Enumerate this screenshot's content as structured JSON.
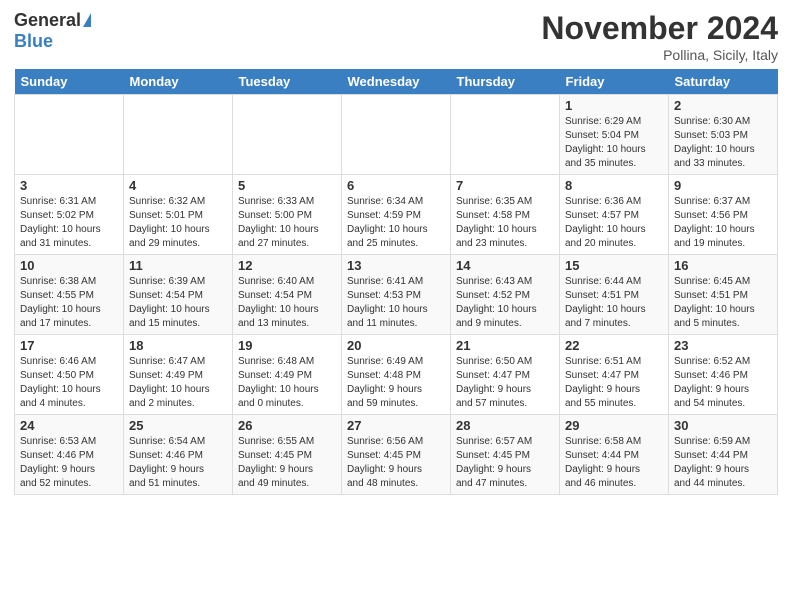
{
  "header": {
    "logo_general": "General",
    "logo_blue": "Blue",
    "month_title": "November 2024",
    "subtitle": "Pollina, Sicily, Italy"
  },
  "days_of_week": [
    "Sunday",
    "Monday",
    "Tuesday",
    "Wednesday",
    "Thursday",
    "Friday",
    "Saturday"
  ],
  "weeks": [
    [
      {
        "day": "",
        "info": ""
      },
      {
        "day": "",
        "info": ""
      },
      {
        "day": "",
        "info": ""
      },
      {
        "day": "",
        "info": ""
      },
      {
        "day": "",
        "info": ""
      },
      {
        "day": "1",
        "info": "Sunrise: 6:29 AM\nSunset: 5:04 PM\nDaylight: 10 hours\nand 35 minutes."
      },
      {
        "day": "2",
        "info": "Sunrise: 6:30 AM\nSunset: 5:03 PM\nDaylight: 10 hours\nand 33 minutes."
      }
    ],
    [
      {
        "day": "3",
        "info": "Sunrise: 6:31 AM\nSunset: 5:02 PM\nDaylight: 10 hours\nand 31 minutes."
      },
      {
        "day": "4",
        "info": "Sunrise: 6:32 AM\nSunset: 5:01 PM\nDaylight: 10 hours\nand 29 minutes."
      },
      {
        "day": "5",
        "info": "Sunrise: 6:33 AM\nSunset: 5:00 PM\nDaylight: 10 hours\nand 27 minutes."
      },
      {
        "day": "6",
        "info": "Sunrise: 6:34 AM\nSunset: 4:59 PM\nDaylight: 10 hours\nand 25 minutes."
      },
      {
        "day": "7",
        "info": "Sunrise: 6:35 AM\nSunset: 4:58 PM\nDaylight: 10 hours\nand 23 minutes."
      },
      {
        "day": "8",
        "info": "Sunrise: 6:36 AM\nSunset: 4:57 PM\nDaylight: 10 hours\nand 20 minutes."
      },
      {
        "day": "9",
        "info": "Sunrise: 6:37 AM\nSunset: 4:56 PM\nDaylight: 10 hours\nand 19 minutes."
      }
    ],
    [
      {
        "day": "10",
        "info": "Sunrise: 6:38 AM\nSunset: 4:55 PM\nDaylight: 10 hours\nand 17 minutes."
      },
      {
        "day": "11",
        "info": "Sunrise: 6:39 AM\nSunset: 4:54 PM\nDaylight: 10 hours\nand 15 minutes."
      },
      {
        "day": "12",
        "info": "Sunrise: 6:40 AM\nSunset: 4:54 PM\nDaylight: 10 hours\nand 13 minutes."
      },
      {
        "day": "13",
        "info": "Sunrise: 6:41 AM\nSunset: 4:53 PM\nDaylight: 10 hours\nand 11 minutes."
      },
      {
        "day": "14",
        "info": "Sunrise: 6:43 AM\nSunset: 4:52 PM\nDaylight: 10 hours\nand 9 minutes."
      },
      {
        "day": "15",
        "info": "Sunrise: 6:44 AM\nSunset: 4:51 PM\nDaylight: 10 hours\nand 7 minutes."
      },
      {
        "day": "16",
        "info": "Sunrise: 6:45 AM\nSunset: 4:51 PM\nDaylight: 10 hours\nand 5 minutes."
      }
    ],
    [
      {
        "day": "17",
        "info": "Sunrise: 6:46 AM\nSunset: 4:50 PM\nDaylight: 10 hours\nand 4 minutes."
      },
      {
        "day": "18",
        "info": "Sunrise: 6:47 AM\nSunset: 4:49 PM\nDaylight: 10 hours\nand 2 minutes."
      },
      {
        "day": "19",
        "info": "Sunrise: 6:48 AM\nSunset: 4:49 PM\nDaylight: 10 hours\nand 0 minutes."
      },
      {
        "day": "20",
        "info": "Sunrise: 6:49 AM\nSunset: 4:48 PM\nDaylight: 9 hours\nand 59 minutes."
      },
      {
        "day": "21",
        "info": "Sunrise: 6:50 AM\nSunset: 4:47 PM\nDaylight: 9 hours\nand 57 minutes."
      },
      {
        "day": "22",
        "info": "Sunrise: 6:51 AM\nSunset: 4:47 PM\nDaylight: 9 hours\nand 55 minutes."
      },
      {
        "day": "23",
        "info": "Sunrise: 6:52 AM\nSunset: 4:46 PM\nDaylight: 9 hours\nand 54 minutes."
      }
    ],
    [
      {
        "day": "24",
        "info": "Sunrise: 6:53 AM\nSunset: 4:46 PM\nDaylight: 9 hours\nand 52 minutes."
      },
      {
        "day": "25",
        "info": "Sunrise: 6:54 AM\nSunset: 4:46 PM\nDaylight: 9 hours\nand 51 minutes."
      },
      {
        "day": "26",
        "info": "Sunrise: 6:55 AM\nSunset: 4:45 PM\nDaylight: 9 hours\nand 49 minutes."
      },
      {
        "day": "27",
        "info": "Sunrise: 6:56 AM\nSunset: 4:45 PM\nDaylight: 9 hours\nand 48 minutes."
      },
      {
        "day": "28",
        "info": "Sunrise: 6:57 AM\nSunset: 4:45 PM\nDaylight: 9 hours\nand 47 minutes."
      },
      {
        "day": "29",
        "info": "Sunrise: 6:58 AM\nSunset: 4:44 PM\nDaylight: 9 hours\nand 46 minutes."
      },
      {
        "day": "30",
        "info": "Sunrise: 6:59 AM\nSunset: 4:44 PM\nDaylight: 9 hours\nand 44 minutes."
      }
    ]
  ]
}
